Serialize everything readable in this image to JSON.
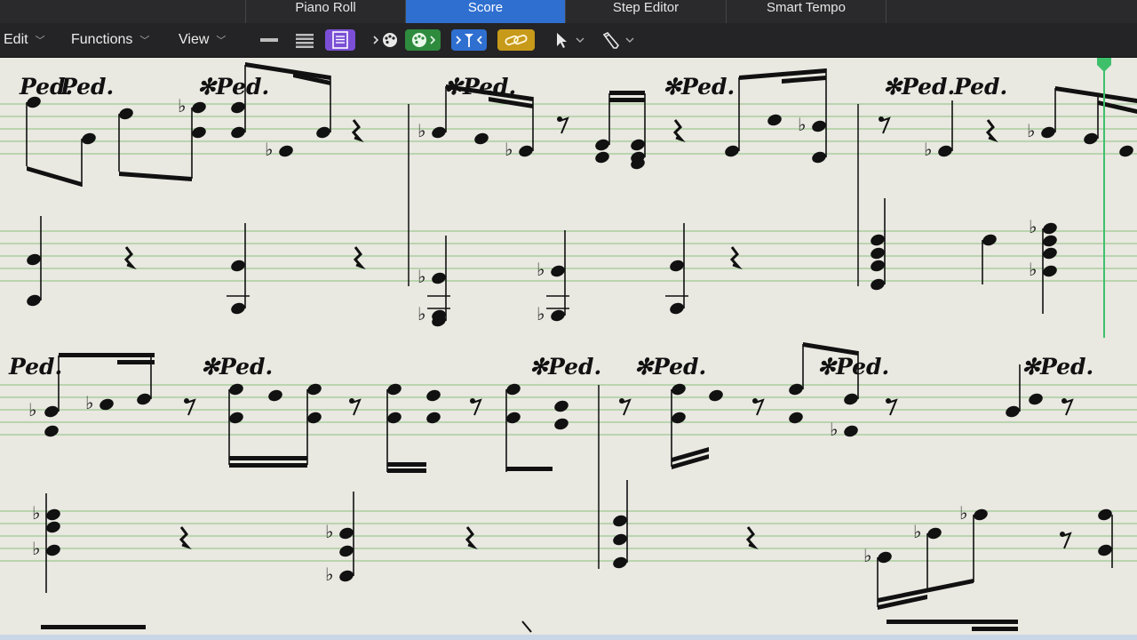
{
  "tabs": [
    {
      "label": "Piano Roll",
      "active": false
    },
    {
      "label": "Score",
      "active": true
    },
    {
      "label": "Step Editor",
      "active": false
    },
    {
      "label": "Smart Tempo",
      "active": false
    }
  ],
  "menus": {
    "edit": "Edit",
    "functions": "Functions",
    "view": "View"
  },
  "toolbar_buttons": [
    {
      "name": "single-staff-view",
      "icon": "single-line-icon"
    },
    {
      "name": "multi-staff-view",
      "icon": "multi-line-icon"
    },
    {
      "name": "page-view",
      "icon": "page-view-icon",
      "selected": true
    },
    {
      "name": "midi-in",
      "icon": "palette-in-icon"
    },
    {
      "name": "midi-out",
      "icon": "palette-out-icon",
      "active": true
    },
    {
      "name": "catch-playhead",
      "icon": "catch-icon",
      "active": true
    },
    {
      "name": "link",
      "icon": "link-icon",
      "active": true
    },
    {
      "name": "pointer-tool",
      "icon": "pointer-icon"
    },
    {
      "name": "pencil-tool",
      "icon": "pencil-icon"
    }
  ],
  "score": {
    "pedal_text": "Ped.",
    "release_symbol": "✻",
    "accent_colors": {
      "staff_lines": "#8cc07e",
      "playhead": "#3ec06b",
      "page_view_button": "#7a4fd6",
      "active_button": "#2e8b3e",
      "catch_button": "#2f6fd0",
      "link_button": "#c89a1a"
    }
  }
}
